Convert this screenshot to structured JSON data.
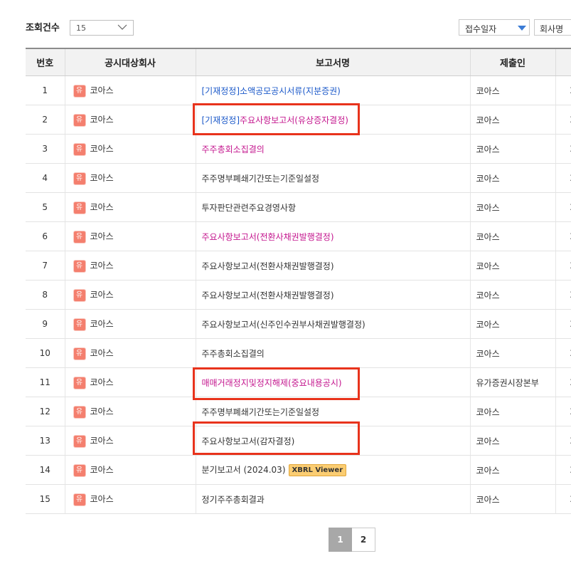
{
  "filter": {
    "count_label": "조회건수",
    "count_value": "15",
    "sort_value": "접수일자",
    "company_button": "회사명"
  },
  "table": {
    "columns": [
      "번호",
      "공시대상회사",
      "보고서명",
      "제출인",
      ""
    ],
    "rows": [
      {
        "no": "1",
        "badge": "유",
        "company": "코아스",
        "report": "[기재정정]소액공모공시서류(지분증권)",
        "report_style": "blue",
        "submitter": "코아스",
        "date": "2"
      },
      {
        "no": "2",
        "badge": "유",
        "company": "코아스",
        "report": "[기재정정]주요사항보고서(유상증자결정)",
        "report_style": "split",
        "submitter": "코아스",
        "date": "2"
      },
      {
        "no": "3",
        "badge": "유",
        "company": "코아스",
        "report": "주주총회소집결의",
        "report_style": "pink",
        "submitter": "코아스",
        "date": "2"
      },
      {
        "no": "4",
        "badge": "유",
        "company": "코아스",
        "report": "주주명부폐쇄기간또는기준일설정",
        "report_style": "normal",
        "submitter": "코아스",
        "date": "2"
      },
      {
        "no": "5",
        "badge": "유",
        "company": "코아스",
        "report": "투자판단관련주요경영사항",
        "report_style": "normal",
        "submitter": "코아스",
        "date": "2"
      },
      {
        "no": "6",
        "badge": "유",
        "company": "코아스",
        "report": "주요사항보고서(전환사채권발행결정)",
        "report_style": "pink",
        "submitter": "코아스",
        "date": "2"
      },
      {
        "no": "7",
        "badge": "유",
        "company": "코아스",
        "report": "주요사항보고서(전환사채권발행결정)",
        "report_style": "normal",
        "submitter": "코아스",
        "date": "2"
      },
      {
        "no": "8",
        "badge": "유",
        "company": "코아스",
        "report": "주요사항보고서(전환사채권발행결정)",
        "report_style": "normal",
        "submitter": "코아스",
        "date": "2"
      },
      {
        "no": "9",
        "badge": "유",
        "company": "코아스",
        "report": "주요사항보고서(신주인수권부사채권발행결정)",
        "report_style": "normal",
        "submitter": "코아스",
        "date": "2"
      },
      {
        "no": "10",
        "badge": "유",
        "company": "코아스",
        "report": "주주총회소집결의",
        "report_style": "normal",
        "submitter": "코아스",
        "date": "2"
      },
      {
        "no": "11",
        "badge": "유",
        "company": "코아스",
        "report": "매매거래정지및정지해제(중요내용공시)",
        "report_style": "pink",
        "submitter": "유가증권시장본부",
        "date": "2"
      },
      {
        "no": "12",
        "badge": "유",
        "company": "코아스",
        "report": "주주명부폐쇄기간또는기준일설정",
        "report_style": "normal",
        "submitter": "코아스",
        "date": "2"
      },
      {
        "no": "13",
        "badge": "유",
        "company": "코아스",
        "report": "주요사항보고서(감자결정)",
        "report_style": "normal",
        "submitter": "코아스",
        "date": "2"
      },
      {
        "no": "14",
        "badge": "유",
        "company": "코아스",
        "report": "분기보고서 (2024.03)",
        "report_style": "normal",
        "xbrl": "XBRL Viewer",
        "submitter": "코아스",
        "date": "2"
      },
      {
        "no": "15",
        "badge": "유",
        "company": "코아스",
        "report": "정기주주총회결과",
        "report_style": "normal",
        "submitter": "코아스",
        "date": "2"
      }
    ]
  },
  "split_prefix": "[기재정정]",
  "split_suffix": "주요사항보고서(유상증자결정)",
  "pagination": {
    "pages": [
      "1",
      "2"
    ],
    "current": "1"
  },
  "colors": {
    "highlight": "#e8331c",
    "link_blue": "#1a58c9",
    "link_pink": "#c4168e",
    "badge": "#f47f6e"
  }
}
